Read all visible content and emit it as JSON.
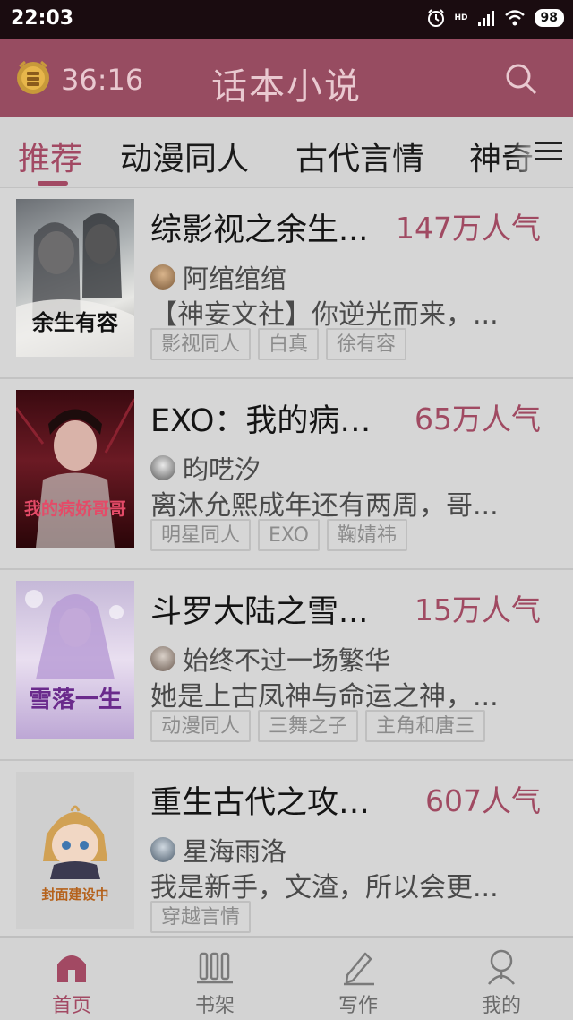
{
  "status_bar": {
    "time": "22:03",
    "network": "HD",
    "battery": "98"
  },
  "app_bar": {
    "timer": "36:16",
    "title": "话本小说"
  },
  "tabs": [
    {
      "label": "推荐"
    },
    {
      "label": "动漫同人"
    },
    {
      "label": "古代言情"
    },
    {
      "label": "神奇"
    }
  ],
  "books": [
    {
      "title": "综影视之余生...",
      "popularity": "147万人气",
      "author": "阿绾绾绾",
      "summary": "【神妄文社】你逆光而来，...",
      "tags": [
        "影视同人",
        "白真",
        "徐有容"
      ],
      "cover_text": "余生有容"
    },
    {
      "title": "EXO：我的病娇...",
      "popularity": "65万人气",
      "author": "昀呓汐",
      "summary": "离沐允熙成年还有两周，哥...",
      "tags": [
        "明星同人",
        "EXO",
        "鞠婧祎"
      ],
      "cover_text": "我的病娇哥哥"
    },
    {
      "title": "斗罗大陆之雪...",
      "popularity": "15万人气",
      "author": "始终不过一场繁华",
      "summary": "她是上古凤神与命运之神，...",
      "tags": [
        "动漫同人",
        "三舞之子",
        "主角和唐三"
      ],
      "cover_text": "雪落一生"
    },
    {
      "title": "重生古代之攻略...",
      "popularity": "607人气",
      "author": "星海雨洛",
      "summary": "我是新手，文渣，所以会更...",
      "tags": [
        "穿越言情"
      ],
      "cover_text": "封面建设中"
    }
  ],
  "bottom_nav": [
    {
      "label": "首页"
    },
    {
      "label": "书架"
    },
    {
      "label": "写作"
    },
    {
      "label": "我的"
    }
  ],
  "colors": {
    "accent": "#a24963",
    "appbar": "#974c61"
  }
}
